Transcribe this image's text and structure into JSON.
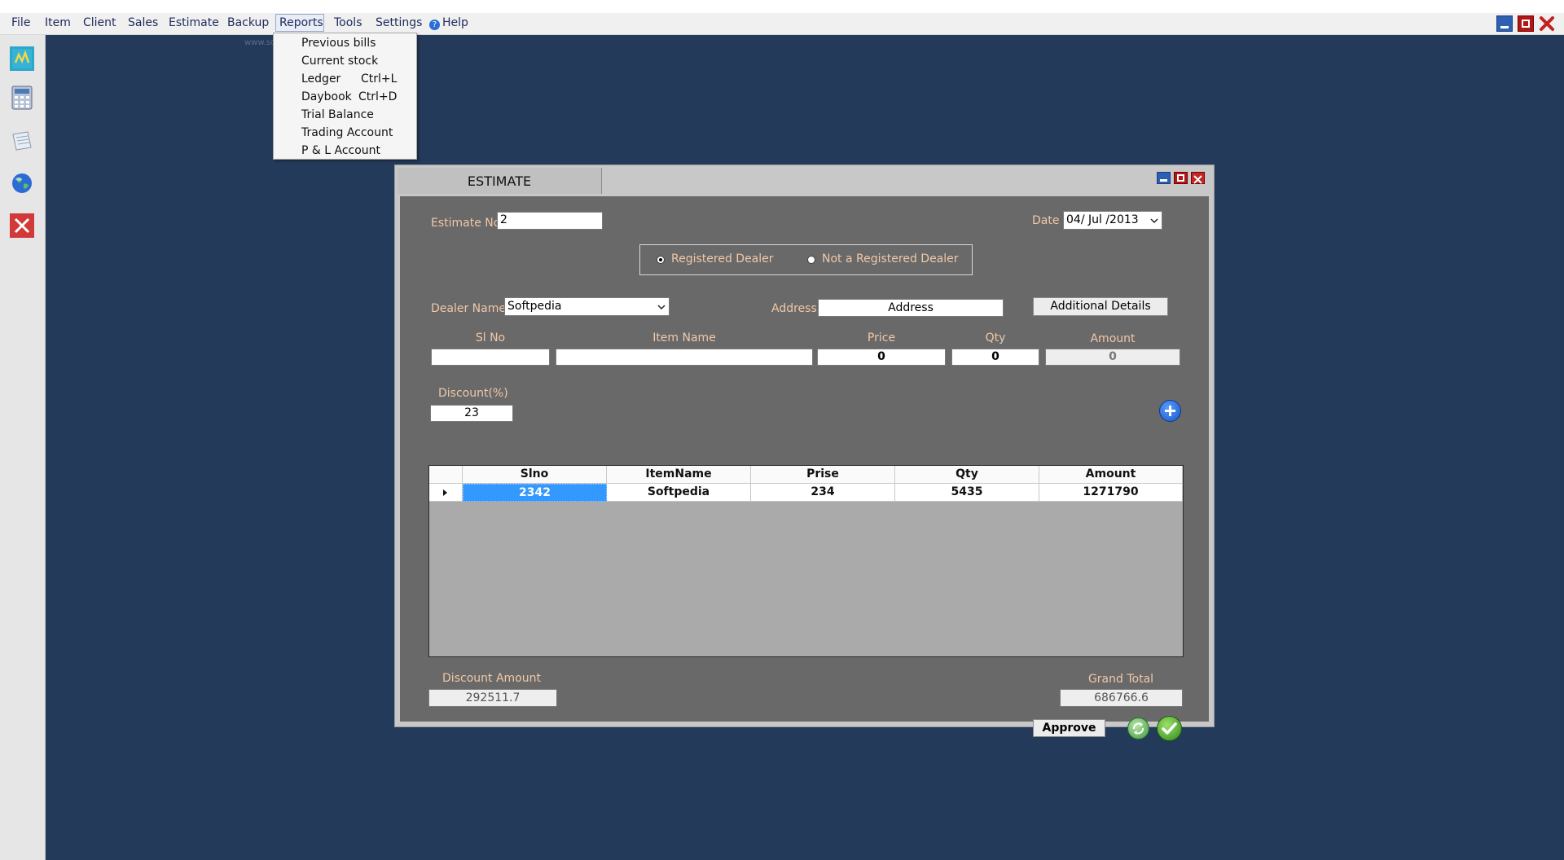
{
  "menubar": {
    "items": [
      "File",
      "Item",
      "Client",
      "Sales",
      "Estimate",
      "Backup",
      "Reports",
      "Tools",
      "Settings",
      "Help"
    ]
  },
  "watermark": "www.softpedia.com",
  "reports_menu": {
    "items": [
      {
        "label": "Previous bills",
        "shortcut": ""
      },
      {
        "label": "Current stock",
        "shortcut": ""
      },
      {
        "label": "Ledger",
        "shortcut": "Ctrl+L"
      },
      {
        "label": "Daybook",
        "shortcut": "Ctrl+D"
      },
      {
        "label": "Trial Balance",
        "shortcut": ""
      },
      {
        "label": "Trading Account",
        "shortcut": ""
      },
      {
        "label": "P & L Account",
        "shortcut": ""
      }
    ]
  },
  "toolbar_icons": [
    "dm-icon",
    "calculator-icon",
    "notes-icon",
    "globe-icon",
    "exit-icon"
  ],
  "estimate": {
    "tab_title": "ESTIMATE",
    "estimate_no_label": "Estimate No",
    "estimate_no_value": "2",
    "date_label": "Date",
    "date_value": "04/ Jul /2013",
    "radio_registered": "Registered Dealer",
    "radio_not_registered": "Not a Registered Dealer",
    "dealer_name_label": "Dealer Name",
    "dealer_name_value": "Softpedia",
    "address_label": "Address",
    "address_value": "Address",
    "additional_details": "Additional Details",
    "entry_headers": {
      "slno": "Sl No",
      "item": "Item Name",
      "price": "Price",
      "qty": "Qty",
      "amount": "Amount"
    },
    "entry_values": {
      "slno": "",
      "item": "",
      "price": "0",
      "qty": "0",
      "amount": "0"
    },
    "discount_label": "Discount(%)",
    "discount_value": "23",
    "grid": {
      "columns": [
        "Slno",
        "ItemName",
        "Prise",
        "Qty",
        "Amount"
      ],
      "rows": [
        [
          "2342",
          "Softpedia",
          "234",
          "5435",
          "1271790"
        ]
      ]
    },
    "discount_amount_label": "Discount Amount",
    "discount_amount_value": "292511.7",
    "grand_total_label": "Grand Total",
    "grand_total_value": "686766.6",
    "approve": "Approve"
  },
  "colors": {
    "workspace": "#243a5b",
    "panel": "#696969",
    "label": "#f0c8a8",
    "selection": "#3399ff"
  }
}
